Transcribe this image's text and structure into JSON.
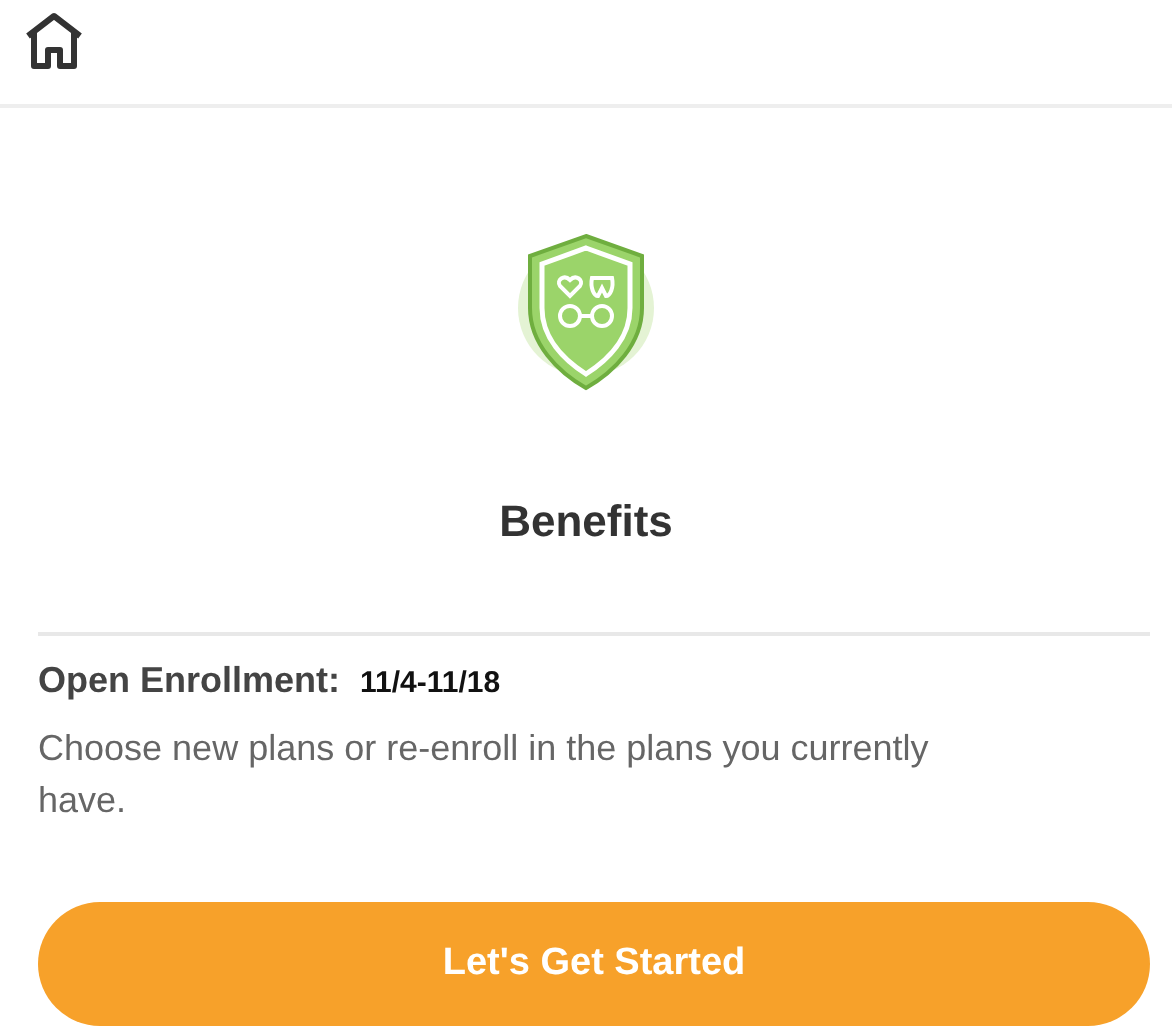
{
  "title": "Benefits",
  "enrollment": {
    "label": "Open Enrollment:",
    "dates": "11/4-11/18"
  },
  "description": "Choose new plans or re-enroll in the plans you currently have.",
  "button": {
    "label": "Let's Get Started"
  }
}
